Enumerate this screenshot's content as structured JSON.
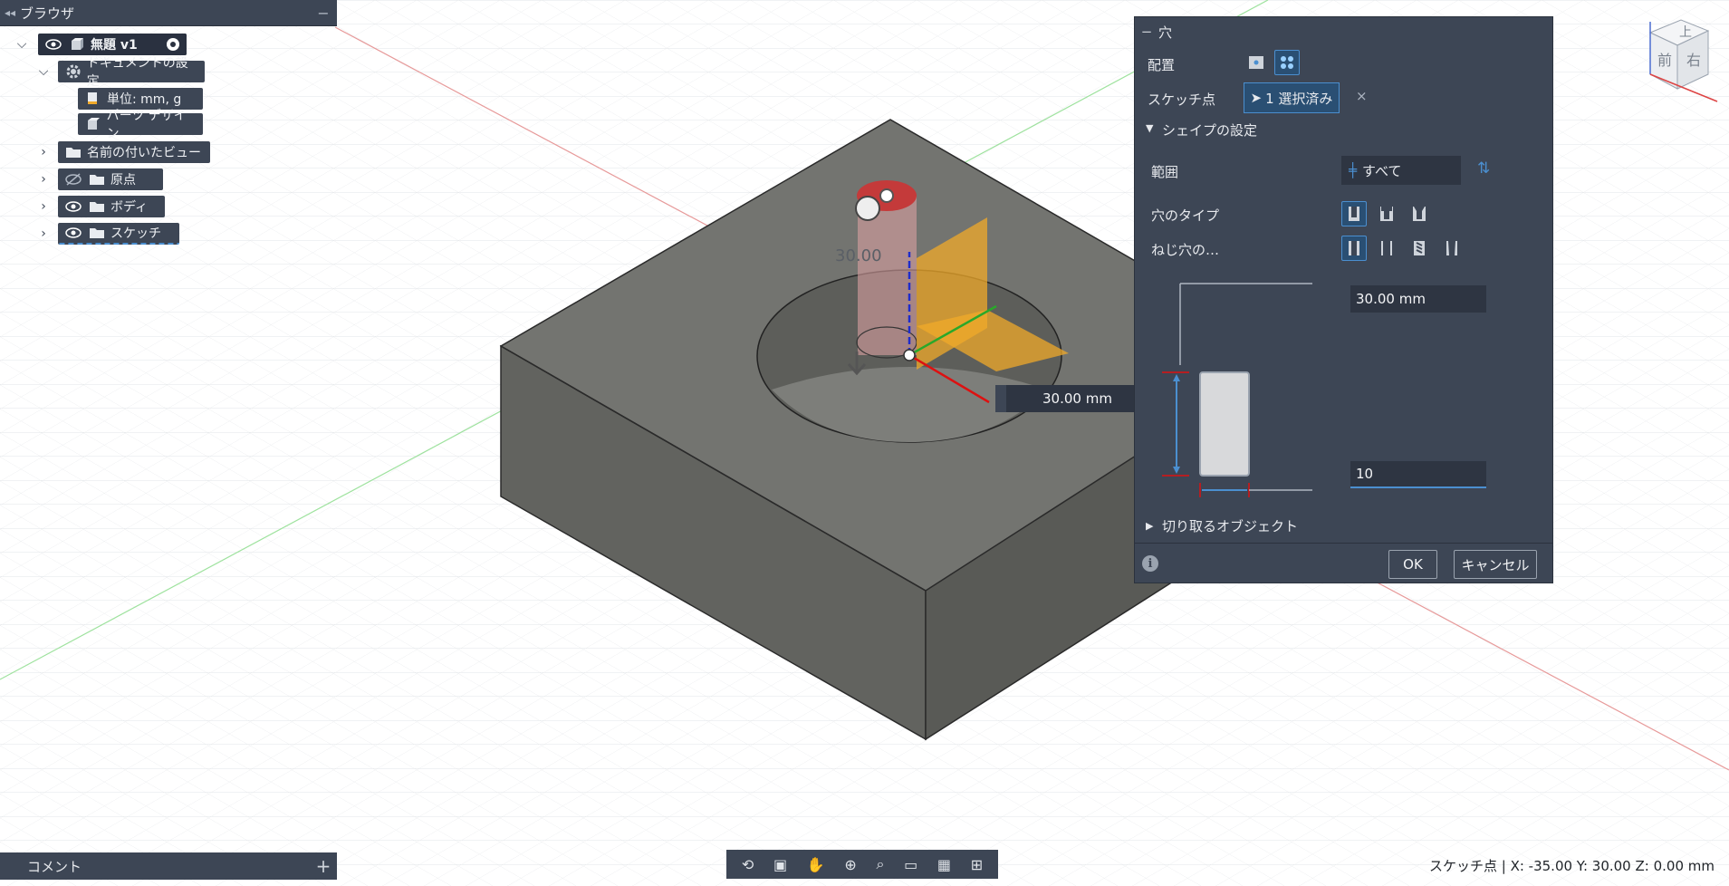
{
  "browser": {
    "title": "ブラウザ",
    "root": "無題 v1",
    "items": [
      {
        "label": "ドキュメントの設定"
      },
      {
        "label": "単位: mm, g"
      },
      {
        "label": "パーツ デザイン"
      },
      {
        "label": "名前の付いたビュー"
      },
      {
        "label": "原点"
      },
      {
        "label": "ボディ"
      },
      {
        "label": "スケッチ"
      }
    ]
  },
  "comment": {
    "title": "コメント"
  },
  "hole_dialog": {
    "title": "穴",
    "placement_label": "配置",
    "sketch_points_label": "スケッチ点",
    "selection_text": "1 選択済み",
    "shape_settings_label": "シェイプの設定",
    "extent_label": "範囲",
    "extent_value": "すべて",
    "hole_type_label": "穴のタイプ",
    "tap_type_label": "ねじ穴の…",
    "depth_value": "30.00 mm",
    "diameter_value": "10",
    "objects_to_cut_label": "切り取るオブジェクト",
    "ok_label": "OK",
    "cancel_label": "キャンセル"
  },
  "canvas": {
    "dimension_input": "30.00 mm",
    "dimension_text": "30.00"
  },
  "viewcube": {
    "top": "上",
    "front": "前",
    "right": "右"
  },
  "status": {
    "text": "スケッチ点 | X: -35.00 Y: 30.00 Z: 0.00 mm"
  },
  "colors": {
    "panel": "#3d4655",
    "accent": "#4b8fd0",
    "body": "#6b6c67"
  }
}
